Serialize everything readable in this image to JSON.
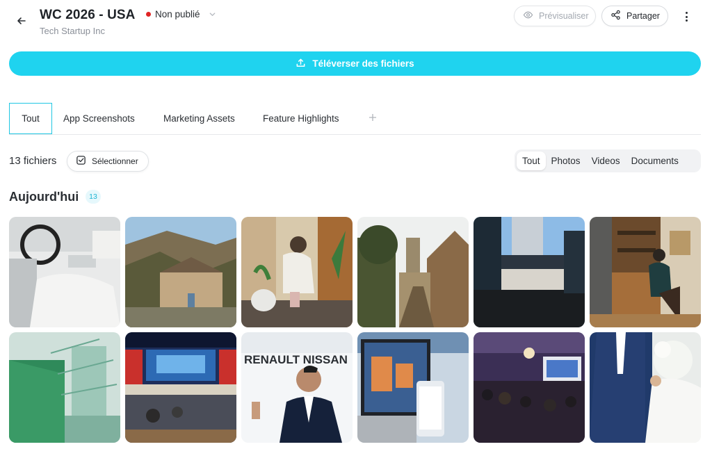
{
  "header": {
    "title": "WC 2026 - USA",
    "subtitle": "Tech Startup Inc",
    "status_label": "Non publié",
    "status_color": "#e02424",
    "preview_label": "Prévisualiser",
    "share_label": "Partager",
    "icons": [
      "arrow-left-icon",
      "chevron-down-icon",
      "eye-icon",
      "share-icon",
      "more-vertical-icon"
    ]
  },
  "upload": {
    "label": "Téléverser des fichiers",
    "icon": "upload-icon",
    "color": "#1fd3ef"
  },
  "tabs": [
    {
      "label": "Tout",
      "active": true
    },
    {
      "label": "App Screenshots"
    },
    {
      "label": "Marketing Assets"
    },
    {
      "label": "Feature Highlights"
    }
  ],
  "toolbar": {
    "count_label": "13 fichiers",
    "select_label": "Sélectionner",
    "filters": [
      {
        "label": "Tout",
        "active": true
      },
      {
        "label": "Photos"
      },
      {
        "label": "Videos"
      },
      {
        "label": "Documents"
      }
    ]
  },
  "section": {
    "title": "Aujourd'hui",
    "badge": "13",
    "photos": [
      {
        "subject": "car-interior"
      },
      {
        "subject": "cliff-village"
      },
      {
        "subject": "woman-gardening"
      },
      {
        "subject": "medieval-street"
      },
      {
        "subject": "modern-building"
      },
      {
        "subject": "home-office"
      },
      {
        "subject": "green-industrial"
      },
      {
        "subject": "conference-hall-flags"
      },
      {
        "subject": "renault-nissan-speaker",
        "sign_text": "RENAULT NISSAN"
      },
      {
        "subject": "laptop-phone"
      },
      {
        "subject": "event-audience"
      },
      {
        "subject": "wedding-couple"
      }
    ]
  }
}
